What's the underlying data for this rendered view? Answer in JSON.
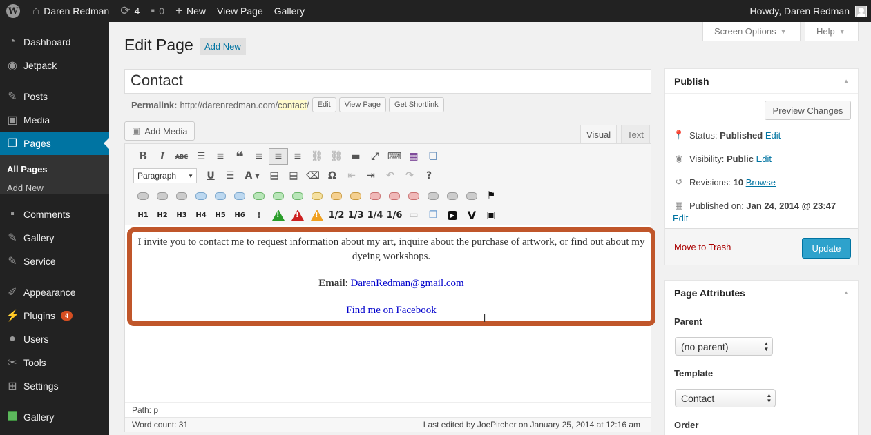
{
  "adminbar": {
    "site_name": "Daren Redman",
    "updates_count": "4",
    "comments_count": "0",
    "new_label": "New",
    "view_page": "View Page",
    "gallery": "Gallery",
    "howdy": "Howdy, Daren Redman"
  },
  "menu": {
    "items": [
      {
        "label": "Dashboard"
      },
      {
        "label": "Jetpack"
      },
      {
        "label": "Posts"
      },
      {
        "label": "Media"
      },
      {
        "label": "Pages"
      },
      {
        "label": "Comments"
      },
      {
        "label": "Gallery"
      },
      {
        "label": "Service"
      },
      {
        "label": "Appearance"
      },
      {
        "label": "Plugins",
        "badge": "4"
      },
      {
        "label": "Users"
      },
      {
        "label": "Tools"
      },
      {
        "label": "Settings"
      },
      {
        "label": "Gallery"
      }
    ],
    "submenu": [
      "All Pages",
      "Add New"
    ]
  },
  "header": {
    "screen_options": "Screen Options",
    "help": "Help",
    "title": "Edit Page",
    "add_new": "Add New"
  },
  "post": {
    "title": "Contact",
    "permalink_label": "Permalink:",
    "permalink_base": "http://darenredman.com/",
    "permalink_slug": "contact",
    "permalink_end": "/",
    "edit_btn": "Edit",
    "view_btn": "View Page",
    "shortlink_btn": "Get Shortlink"
  },
  "editor": {
    "add_media": "Add Media",
    "tab_visual": "Visual",
    "tab_text": "Text",
    "format_select": "Paragraph",
    "headings": [
      "H1",
      "H2",
      "H3",
      "H4",
      "H5",
      "H6"
    ],
    "fractions": [
      "1/2",
      "1/3",
      "1/4",
      "1/6"
    ],
    "content": {
      "intro": "I invite you to contact me to request information about my art, inquire about the purchase of artwork, or find out about my dyeing workshops.",
      "email_label": "Email",
      "email": "DarenRedman@gmail.com",
      "facebook": "Find me on Facebook"
    },
    "path": "Path: p",
    "word_count": "Word count: 31",
    "last_edited": "Last edited by JoePitcher on January 25, 2014 at 12:16 am"
  },
  "publish": {
    "title": "Publish",
    "preview_btn": "Preview Changes",
    "status_label": "Status:",
    "status_value": "Published",
    "visibility_label": "Visibility:",
    "visibility_value": "Public",
    "revisions_label": "Revisions:",
    "revisions_value": "10",
    "browse": "Browse",
    "published_label": "Published on:",
    "published_value": "Jan 24, 2014 @ 23:47",
    "edit": "Edit",
    "trash": "Move to Trash",
    "update": "Update"
  },
  "attributes": {
    "title": "Page Attributes",
    "parent_label": "Parent",
    "parent_value": "(no parent)",
    "template_label": "Template",
    "template_value": "Contact",
    "order_label": "Order"
  },
  "colors": {
    "adminbar": "#222222",
    "accent": "#0074a2",
    "update_button": "#2ea2cc",
    "highlight_border": "#c0562a",
    "trash": "#a00000"
  }
}
